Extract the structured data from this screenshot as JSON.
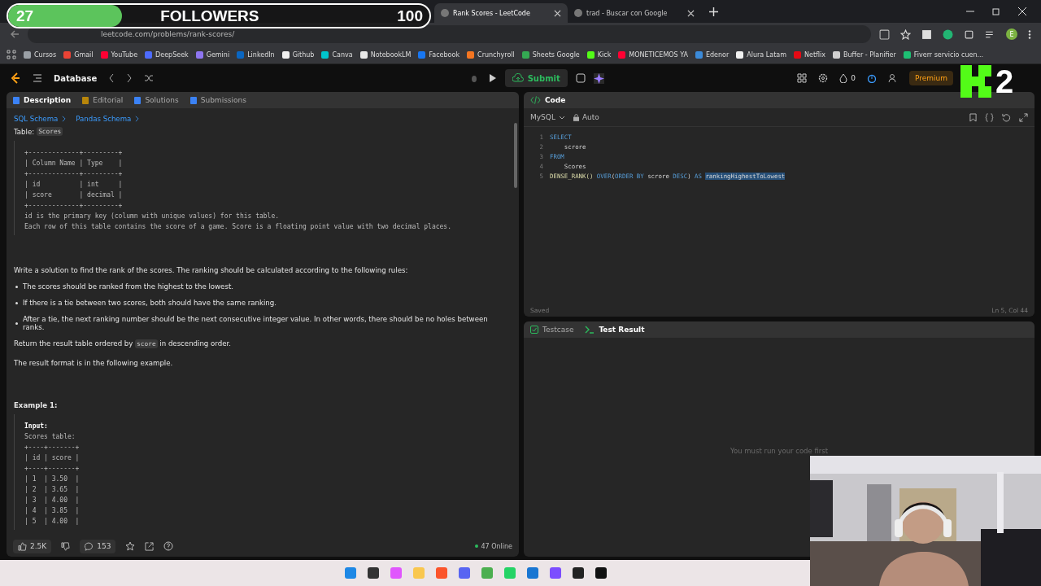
{
  "overlay": {
    "count": "27",
    "label": "FOLLOWERS",
    "goal": "100",
    "level": 0.27
  },
  "browser": {
    "tabs": [
      {
        "title": "Rank Scores - LeetCode",
        "selected": true
      },
      {
        "title": "trad - Buscar con Google",
        "selected": false
      }
    ],
    "url": "leetcode.com/problems/rank-scores/",
    "profile": "E",
    "bookmarks": [
      {
        "label": "Cursos",
        "color": "#9aa0a6"
      },
      {
        "label": "Gmail",
        "color": "#ea4335"
      },
      {
        "label": "YouTube",
        "color": "#ff0033"
      },
      {
        "label": "DeepSeek",
        "color": "#4d6bfe"
      },
      {
        "label": "Gemini",
        "color": "#8e75f0"
      },
      {
        "label": "LinkedIn",
        "color": "#0a66c2"
      },
      {
        "label": "Github",
        "color": "#f0f0f0"
      },
      {
        "label": "Canva",
        "color": "#00c4cc"
      },
      {
        "label": "NotebookLM",
        "color": "#e8e8e8"
      },
      {
        "label": "Facebook",
        "color": "#1877f2"
      },
      {
        "label": "Crunchyroll",
        "color": "#f47521"
      },
      {
        "label": "Sheets Google",
        "color": "#34a853"
      },
      {
        "label": "Kick",
        "color": "#53fc18"
      },
      {
        "label": "MONETICEMOS YA",
        "color": "#ff0033"
      },
      {
        "label": "Edenor",
        "color": "#3b8ad9"
      },
      {
        "label": "Alura Latam",
        "color": "#f0f0f0"
      },
      {
        "label": "Netflix",
        "color": "#e50914"
      },
      {
        "label": "Buffer - Planifier",
        "color": "#d0d0d0"
      },
      {
        "label": "Fiverr  servicio cuen...",
        "color": "#1dbf73"
      }
    ]
  },
  "toolbar": {
    "section": "Database",
    "submit": "Submit",
    "streak": "0",
    "premium": "Premium"
  },
  "description": {
    "tabs": [
      {
        "label": "Description",
        "selected": true
      },
      {
        "label": "Editorial",
        "selected": false
      },
      {
        "label": "Solutions",
        "selected": false
      },
      {
        "label": "Submissions",
        "selected": false
      }
    ],
    "breadcrumbs": [
      "SQL Schema",
      "Pandas Schema"
    ],
    "table_label": "Table:",
    "table_name": "Scores",
    "schema_lines": [
      "+-------------+---------+",
      "| Column Name | Type    |",
      "+-------------+---------+",
      "| id          | int     |",
      "| score       | decimal |",
      "+-------------+---------+",
      "id is the primary key (column with unique values) for this table.",
      "Each row of this table contains the score of a game. Score is a floating point value with two decimal places."
    ],
    "intro": "Write a solution to find the rank of the scores. The ranking should be calculated according to the following rules:",
    "rules": [
      "The scores should be ranked from the highest to the lowest.",
      "If there is a tie between two scores, both should have the same ranking.",
      "After a tie, the next ranking number should be the next consecutive integer value. In other words, there should be no holes between ranks."
    ],
    "return_text": {
      "before": "Return the result table ordered by",
      "code": "score",
      "after": "in descending order."
    },
    "format_text": "The result format is in the following example.",
    "example_title": "Example 1:",
    "example_label": "Input:",
    "example_lines": [
      "Scores table:",
      "+----+-------+",
      "| id | score |",
      "+----+-------+",
      "| 1  | 3.50  |",
      "| 2  | 3.65  |",
      "| 3  | 4.00  |",
      "| 4  | 3.85  |",
      "| 5  | 4.00  |"
    ]
  },
  "footer": {
    "likes": "2.5K",
    "comments": "153",
    "online": "47 Online"
  },
  "editor": {
    "title": "Code",
    "language": "MySQL",
    "mode": "Auto",
    "status": "Saved",
    "cursor": "Ln 5, Col 44",
    "lines": [
      {
        "number": "1",
        "tokens": [
          {
            "text": "SELECT",
            "kind": "keyword"
          }
        ]
      },
      {
        "number": "2",
        "tokens": [
          {
            "text": "    scrore",
            "kind": "plain"
          }
        ]
      },
      {
        "number": "3",
        "tokens": [
          {
            "text": "FROM",
            "kind": "keyword"
          }
        ]
      },
      {
        "number": "4",
        "tokens": [
          {
            "text": "    Scores",
            "kind": "plain"
          }
        ]
      },
      {
        "number": "5",
        "tokens": [
          {
            "text": "DENSE_RANK()",
            "kind": "function"
          },
          {
            "text": " OVER",
            "kind": "keyword"
          },
          {
            "text": "(",
            "kind": "plain"
          },
          {
            "text": "ORDER BY",
            "kind": "keyword"
          },
          {
            "text": " scrore ",
            "kind": "plain"
          },
          {
            "text": "DESC",
            "kind": "keyword"
          },
          {
            "text": ") ",
            "kind": "plain"
          },
          {
            "text": "AS ",
            "kind": "keyword"
          },
          {
            "text": "rankingHighestToLowest",
            "kind": "selected"
          }
        ]
      }
    ]
  },
  "results": {
    "tabs": [
      {
        "label": "Testcase",
        "selected": false
      },
      {
        "label": "Test Result",
        "selected": true
      }
    ],
    "message": "You must run your code first"
  },
  "stream_logo": {
    "text": "2"
  }
}
